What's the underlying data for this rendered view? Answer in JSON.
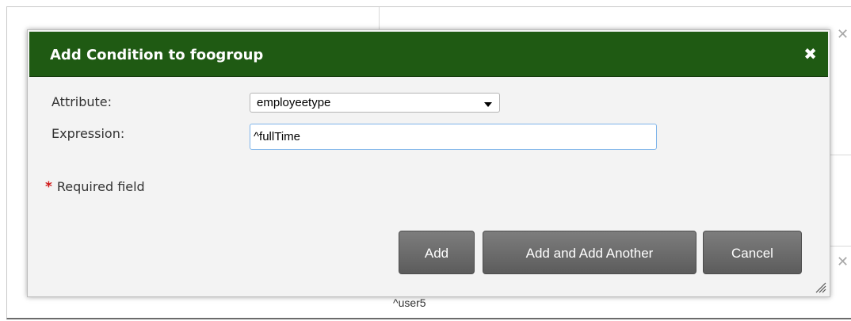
{
  "dialog": {
    "title": "Add Condition to foogroup",
    "close_icon": "close-x-icon"
  },
  "form": {
    "attribute_label": "Attribute:",
    "attribute_value": "employeetype",
    "expression_label": "Expression:",
    "expression_value": "^fullTime"
  },
  "required_note": {
    "star": "*",
    "text": "Required field"
  },
  "buttons": {
    "add": "Add",
    "add_another": "Add and Add Another",
    "cancel": "Cancel"
  },
  "background": {
    "visible_text": "^user5"
  },
  "colors": {
    "titlebar": "#1f5a13",
    "button": "#6b6b6b",
    "required_star": "#d01818"
  }
}
